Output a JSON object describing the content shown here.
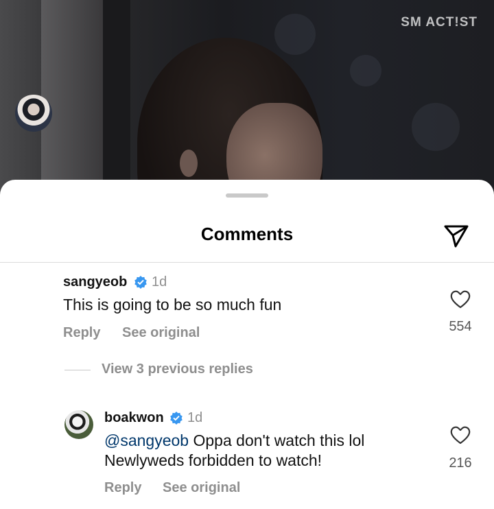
{
  "video": {
    "watermark": "SM ACT!ST"
  },
  "sheet": {
    "title": "Comments",
    "send_icon": "paper-plane-icon"
  },
  "comments": [
    {
      "username": "sangyeob",
      "verified": true,
      "time": "1d",
      "text": "This is going to be so much fun",
      "likes": "554",
      "reply_label": "Reply",
      "see_original_label": "See original"
    }
  ],
  "view_previous_replies": "View 3 previous replies",
  "replies": [
    {
      "username": "boakwon",
      "verified": true,
      "time": "1d",
      "mention": "@sangyeob",
      "text_line1": " Oppa don't watch this lol",
      "text_line2": "Newlyweds forbidden to watch!",
      "likes": "216",
      "reply_label": "Reply",
      "see_original_label": "See original"
    }
  ],
  "colors": {
    "verified": "#3897f0",
    "mention": "#00376b",
    "muted": "#8e8e8e"
  }
}
